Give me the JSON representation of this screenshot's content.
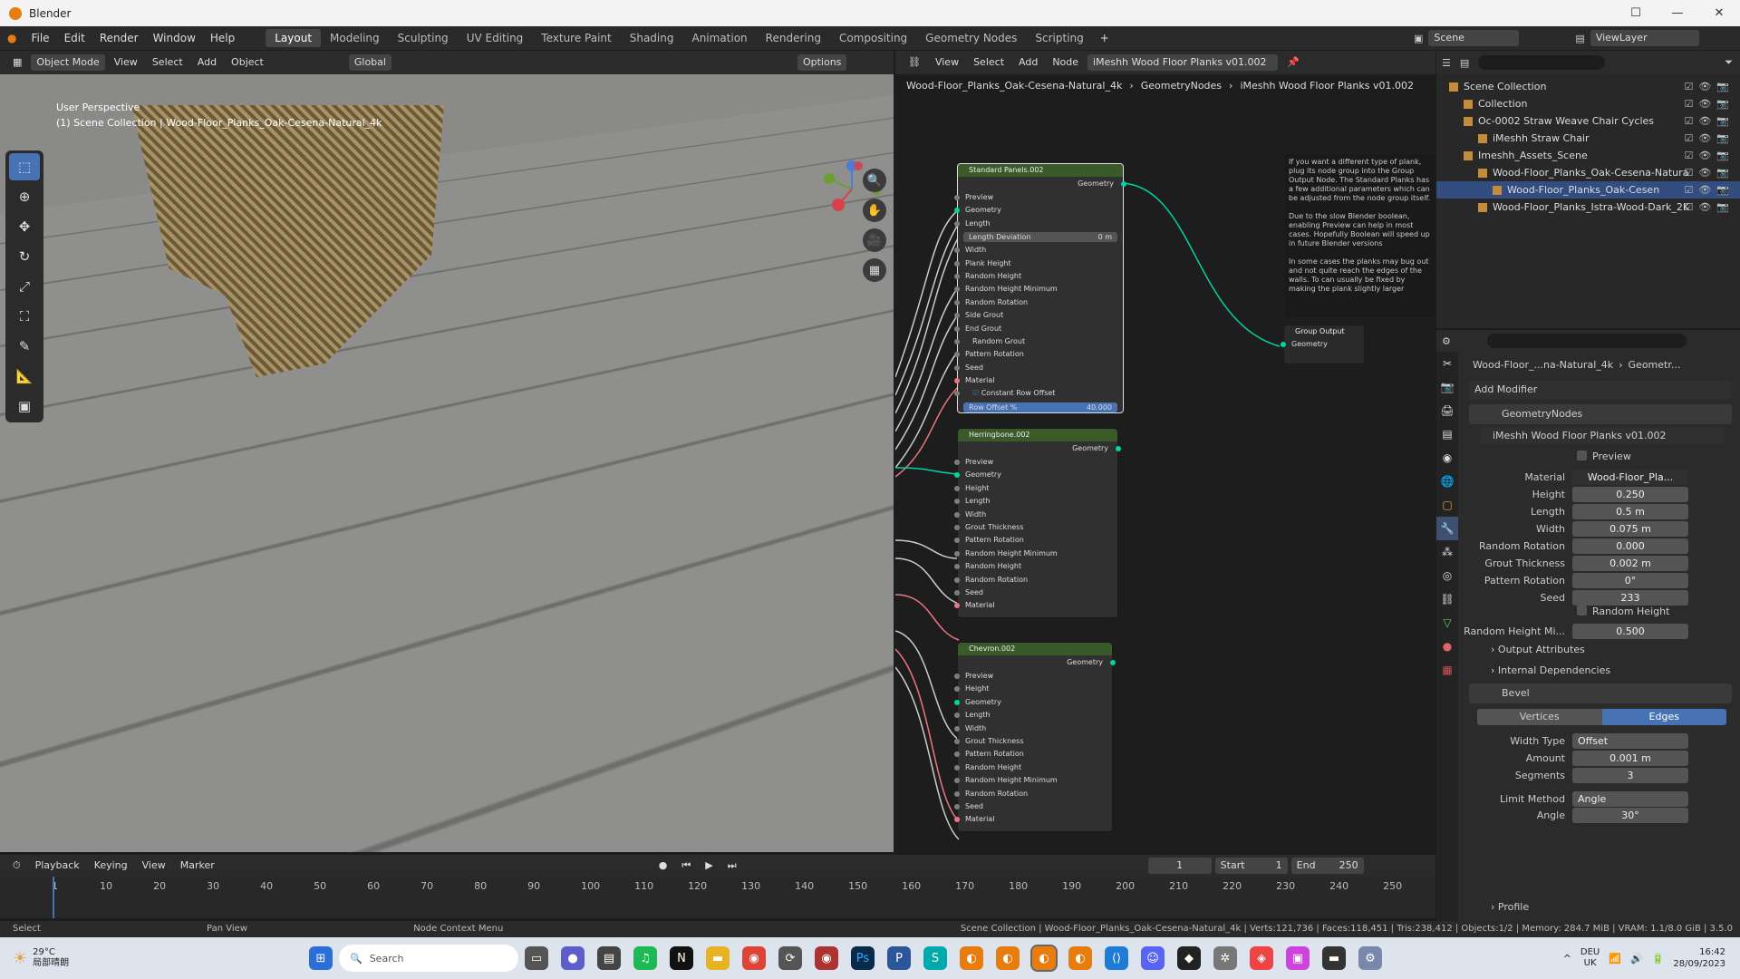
{
  "window": {
    "title": "Blender"
  },
  "menu": [
    "File",
    "Edit",
    "Render",
    "Window",
    "Help"
  ],
  "workspaces": [
    "Layout",
    "Modeling",
    "Sculpting",
    "UV Editing",
    "Texture Paint",
    "Shading",
    "Animation",
    "Rendering",
    "Compositing",
    "Geometry Nodes",
    "Scripting"
  ],
  "scene": {
    "name": "Scene",
    "view_layer": "ViewLayer"
  },
  "viewport": {
    "header": [
      "Object Mode",
      "View",
      "Select",
      "Add",
      "Object",
      "Global"
    ],
    "options": "Options",
    "overlay_line1": "User Perspective",
    "overlay_line2": "(1) Scene Collection | Wood-Floor_Planks_Oak-Cesena-Natural_4k"
  },
  "node_editor": {
    "header": [
      "View",
      "Select",
      "Add",
      "Node"
    ],
    "tree_name": "iMeshh Wood Floor Planks v01.002",
    "breadcrumb": [
      "Wood-Floor_Planks_Oak-Cesena-Natural_4k",
      "GeometryNodes",
      "iMeshh Wood Floor Planks v01.002"
    ],
    "node1": {
      "title": "Standard Panels.002",
      "output": "Geometry",
      "inputs": [
        "Preview",
        "Geometry",
        "Length"
      ],
      "length_deviation": {
        "label": "Length Deviation",
        "value": "0 m"
      },
      "inputs2": [
        "Width",
        "Plank Height",
        "Random Height",
        "Random Height Minimum",
        "Random Rotation",
        "Side Grout",
        "End Grout"
      ],
      "random_grout": "Random Grout",
      "inputs3": [
        "Pattern Rotation",
        "Seed",
        "Material"
      ],
      "constant_row_offset": "Constant Row Offset",
      "row_offset": {
        "label": "Row Offset %",
        "value": "40.000"
      }
    },
    "node2": {
      "title": "Herringbone.002",
      "output": "Geometry",
      "inputs": [
        "Preview",
        "Geometry",
        "Height",
        "Length",
        "Width",
        "Grout Thickness",
        "Pattern Rotation",
        "Random Height Minimum",
        "Random Height",
        "Random Rotation",
        "Seed",
        "Material"
      ]
    },
    "node3": {
      "title": "Chevron.002",
      "output": "Geometry",
      "inputs": [
        "Preview",
        "Height",
        "Geometry",
        "Length",
        "Width",
        "Grout Thickness",
        "Pattern Rotation",
        "Random Height",
        "Random Height Minimum",
        "Random Rotation",
        "Seed",
        "Material"
      ]
    },
    "group_output": {
      "title": "Group Output",
      "socket": "Geometry"
    },
    "frame_text": "If you want a different type of plank, plug its node group into the Group Output Node. The Standard Planks has a few additional parameters which can be adjusted from the node group itself.\n\nDue to the slow Blender boolean, enabling Preview can help in most cases. Hopefully Boolean will speed up in future Blender versions\n\nIn some cases the planks may bug out and not quite reach the edges of the walls. To can usually be fixed by making the plank slightly larger"
  },
  "outliner": {
    "rows": [
      {
        "label": "Scene Collection",
        "indent": 0
      },
      {
        "label": "Collection",
        "indent": 1
      },
      {
        "label": "Oc-0002 Straw Weave Chair Cycles",
        "indent": 1
      },
      {
        "label": "iMeshh Straw Chair",
        "indent": 2
      },
      {
        "label": "Imeshh_Assets_Scene",
        "indent": 1
      },
      {
        "label": "Wood-Floor_Planks_Oak-Cesena-Natura",
        "indent": 2
      },
      {
        "label": "Wood-Floor_Planks_Oak-Cesen",
        "indent": 3,
        "selected": true
      },
      {
        "label": "Wood-Floor_Planks_Istra-Wood-Dark_2K",
        "indent": 2
      }
    ]
  },
  "properties": {
    "breadcrumb": [
      "Wood-Floor_...na-Natural_4k",
      "Geometr..."
    ],
    "add_modifier": "Add Modifier",
    "modifier1": "GeometryNodes",
    "node_group": "iMeshh Wood Floor Planks v01.002",
    "preview": "Preview",
    "material": {
      "label": "Material",
      "value": "Wood-Floor_Pla..."
    },
    "fields": [
      {
        "label": "Height",
        "value": "0.250"
      },
      {
        "label": "Length",
        "value": "0.5 m"
      },
      {
        "label": "Width",
        "value": "0.075 m"
      },
      {
        "label": "Random Rotation",
        "value": "0.000"
      },
      {
        "label": "Grout Thickness",
        "value": "0.002 m"
      },
      {
        "label": "Pattern Rotation",
        "value": "0°"
      },
      {
        "label": "Seed",
        "value": "233"
      }
    ],
    "random_height": "Random Height",
    "random_height_min": {
      "label": "Random Height Mi...",
      "value": "0.500"
    },
    "output_attributes": "Output Attributes",
    "internal_dependencies": "Internal Dependencies",
    "modifier2": "Bevel",
    "tabs": [
      "Vertices",
      "Edges"
    ],
    "bevel_fields": [
      {
        "label": "Width Type",
        "value": "Offset"
      },
      {
        "label": "Amount",
        "value": "0.001 m"
      },
      {
        "label": "Segments",
        "value": "3"
      },
      {
        "label": "Limit Method",
        "value": "Angle"
      },
      {
        "label": "Angle",
        "value": "30°"
      }
    ],
    "profile": "Profile"
  },
  "timeline": {
    "header": [
      "Playback",
      "Keying",
      "View",
      "Marker"
    ],
    "current_frame": "1",
    "start": {
      "label": "Start",
      "value": "1"
    },
    "end": {
      "label": "End",
      "value": "250"
    },
    "ticks": [
      "1",
      "10",
      "20",
      "30",
      "40",
      "50",
      "60",
      "70",
      "80",
      "90",
      "100",
      "110",
      "120",
      "130",
      "140",
      "150",
      "160",
      "170",
      "180",
      "190",
      "200",
      "210",
      "220",
      "230",
      "240",
      "250"
    ]
  },
  "status": {
    "left": [
      "Select",
      "Pan View",
      "Node Context Menu"
    ],
    "right": "Scene Collection | Wood-Floor_Planks_Oak-Cesena-Natural_4k | Verts:121,736 | Faces:118,451 | Tris:238,412 | Objects:1/2 | Memory: 284.7 MiB | VRAM: 1.1/8.0 GiB | 3.5.0"
  },
  "taskbar": {
    "weather_temp": "29°C",
    "weather_desc": "局部晴朗",
    "search": "Search",
    "lang1": "DEU",
    "lang2": "UK",
    "time": "16:42",
    "date": "28/09/2023"
  }
}
